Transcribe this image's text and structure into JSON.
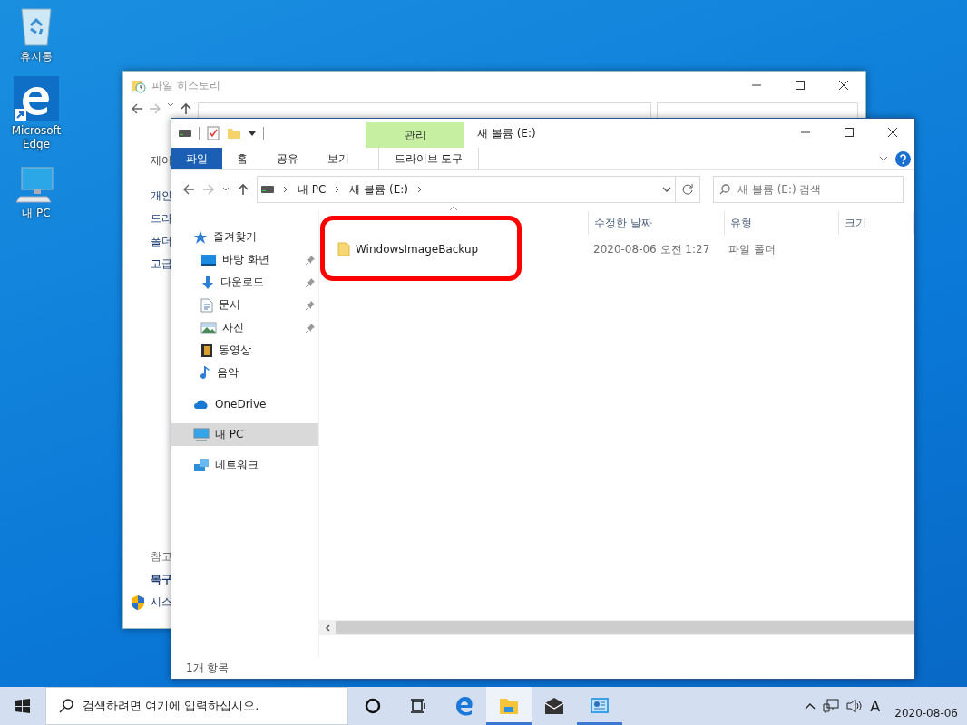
{
  "desktop_icons": [
    {
      "kind": "recycle-bin",
      "label": "휴지통"
    },
    {
      "kind": "edge",
      "label": "Microsoft Edge"
    },
    {
      "kind": "pc",
      "label": "내 PC"
    }
  ],
  "back_window": {
    "title": "파일 히스토리",
    "side_links": [
      {
        "kind": "home",
        "text": "제어"
      },
      {
        "kind": "link",
        "text": "개인"
      },
      {
        "kind": "link",
        "text": "드라"
      },
      {
        "kind": "link",
        "text": "폴더"
      },
      {
        "kind": "link",
        "text": "고급"
      },
      {
        "kind": "heading",
        "text": "참고"
      },
      {
        "kind": "strong",
        "text": "복구"
      },
      {
        "kind": "shield",
        "text": "시스"
      }
    ]
  },
  "explorer": {
    "title": "새 볼륨 (E:)",
    "context_tab": "관리",
    "ribbon_tabs": [
      {
        "kind": "file",
        "label": "파일"
      },
      {
        "kind": "tab",
        "label": "홈"
      },
      {
        "kind": "tab",
        "label": "공유"
      },
      {
        "kind": "tab",
        "label": "보기"
      },
      {
        "kind": "context",
        "label": "드라이브 도구"
      }
    ],
    "address": [
      "내 PC",
      "새 볼륨 (E:)"
    ],
    "search": {
      "placeholder": "새 볼륨 (E:) 검색"
    },
    "nav": [
      {
        "kind": "star",
        "label": "즐겨찾기",
        "selected": false,
        "children": [
          {
            "kind": "desktop",
            "label": "바탕 화면",
            "pinned": true,
            "selected": false
          },
          {
            "kind": "download",
            "label": "다운로드",
            "pinned": true,
            "selected": false
          },
          {
            "kind": "document",
            "label": "문서",
            "pinned": true,
            "selected": false
          },
          {
            "kind": "pictures",
            "label": "사진",
            "pinned": true,
            "selected": false
          },
          {
            "kind": "videos",
            "label": "동영상",
            "pinned": false,
            "selected": false
          },
          {
            "kind": "music",
            "label": "음악",
            "pinned": false,
            "selected": false
          }
        ]
      },
      {
        "kind": "cloud",
        "label": "OneDrive",
        "selected": false
      },
      {
        "kind": "pc",
        "label": "내 PC",
        "selected": true
      },
      {
        "kind": "network",
        "label": "네트워크",
        "selected": false
      }
    ],
    "columns": [
      "수정한 날짜",
      "유형",
      "크기"
    ],
    "rows": [
      {
        "name": "WindowsImageBackup",
        "modified": "2020-08-06 오전 1:27",
        "type": "파일 폴더",
        "highlighted": true
      }
    ],
    "status": "1개 항목"
  },
  "taskbar": {
    "search": {
      "placeholder": "검색하려면 여기에 입력하십시오."
    },
    "apps": [
      {
        "kind": "cortana",
        "running": false,
        "active": false
      },
      {
        "kind": "task-view",
        "running": false,
        "active": false
      },
      {
        "kind": "edge",
        "running": false,
        "active": false
      },
      {
        "kind": "explorer",
        "running": true,
        "active": true
      },
      {
        "kind": "mail",
        "running": false,
        "active": false
      },
      {
        "kind": "control-panel",
        "running": true,
        "active": false
      }
    ],
    "ime": "A",
    "date": "2020-08-06"
  }
}
